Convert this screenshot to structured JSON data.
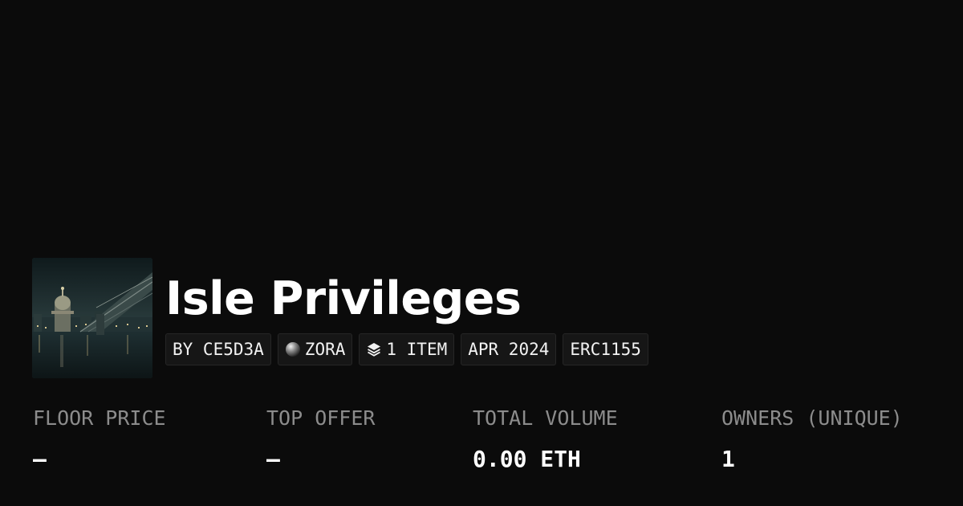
{
  "collection": {
    "title": "Isle Privileges",
    "image_icon": "night-city-bridge-thumbnail"
  },
  "tags": {
    "creator": "BY CE5D3A",
    "chain": "ZORA",
    "chain_icon": "zora-orb-icon",
    "items": "1 ITEM",
    "items_icon": "layers-icon",
    "date": "APR 2024",
    "standard": "ERC1155"
  },
  "stats": {
    "floor_price": {
      "label": "FLOOR PRICE",
      "value": "—"
    },
    "top_offer": {
      "label": "TOP OFFER",
      "value": "—"
    },
    "total_volume": {
      "label": "TOTAL VOLUME",
      "value": "0.00 ETH"
    },
    "owners": {
      "label": "OWNERS (UNIQUE)",
      "value": "1"
    }
  },
  "colors": {
    "background": "#0b0b0b",
    "tag_background": "#161616",
    "label": "#8c8c8c",
    "value": "#ffffff"
  }
}
